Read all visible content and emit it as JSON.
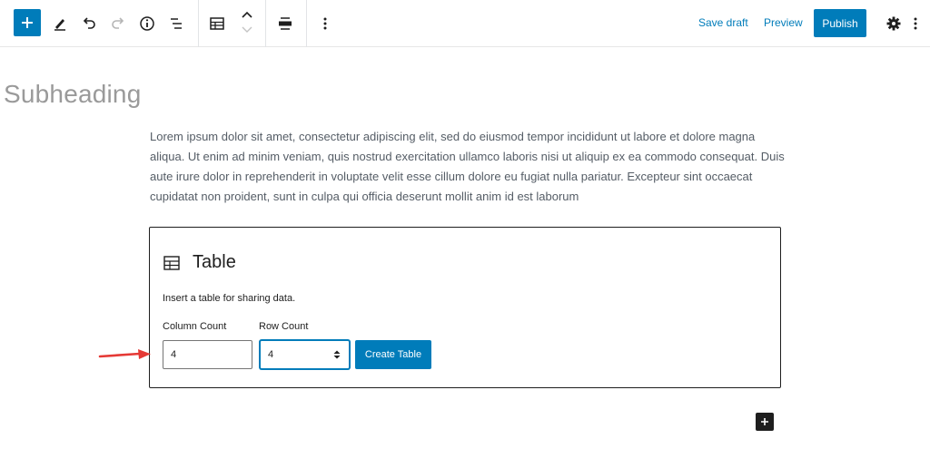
{
  "toolbar": {
    "add_icon": "plus-icon",
    "tools_icon": "pencil-icon",
    "undo_icon": "undo-icon",
    "redo_icon": "redo-icon",
    "info_icon": "info-icon",
    "outline_icon": "list-view-icon",
    "block_type_icon": "table-icon",
    "move_up_icon": "chevron-up-icon",
    "move_down_icon": "chevron-down-icon",
    "align_icon": "align-wide-icon",
    "more_icon": "more-vertical-icon",
    "save_draft": "Save draft",
    "preview": "Preview",
    "publish": "Publish",
    "settings_icon": "gear-icon",
    "options_icon": "more-vertical-icon",
    "accent_color": "#007cba"
  },
  "content": {
    "subheading": "Subheading",
    "paragraph": "Lorem ipsum dolor sit amet, consectetur adipiscing elit, sed do eiusmod tempor incididunt ut labore et dolore magna aliqua. Ut enim ad minim veniam, quis nostrud exercitation ullamco laboris nisi ut aliquip ex ea commodo consequat. Duis aute irure dolor in reprehenderit in voluptate velit esse cillum dolore eu fugiat nulla pariatur. Excepteur sint occaecat cupidatat non proident, sunt in culpa qui officia deserunt mollit anim id est laborum"
  },
  "table_block": {
    "icon": "table-icon",
    "title": "Table",
    "description": "Insert a table for sharing data.",
    "column_label": "Column Count",
    "column_value": "4",
    "row_label": "Row Count",
    "row_value": "4",
    "create_button": "Create Table"
  },
  "annotation": {
    "arrow_color": "#e53935"
  },
  "footer": {
    "add_block_icon": "plus-icon"
  }
}
